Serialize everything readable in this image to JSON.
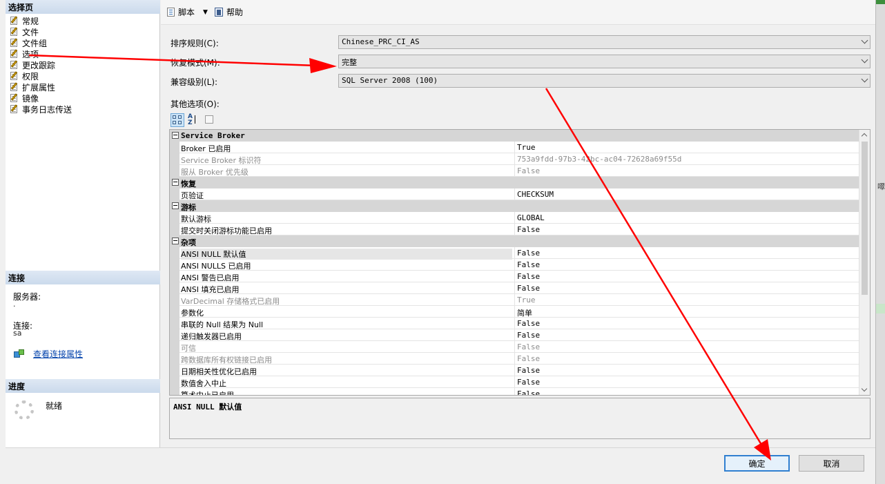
{
  "left": {
    "select_page_header": "选择页",
    "pages": [
      {
        "label": "常规"
      },
      {
        "label": "文件"
      },
      {
        "label": "文件组"
      },
      {
        "label": "选项"
      },
      {
        "label": "更改跟踪"
      },
      {
        "label": "权限"
      },
      {
        "label": "扩展属性"
      },
      {
        "label": "镜像"
      },
      {
        "label": "事务日志传送"
      }
    ],
    "connection_header": "连接",
    "server_label": "服务器:",
    "server_value": ".",
    "connection_label": "连接:",
    "connection_value": "sa",
    "view_connection_link": "查看连接属性",
    "progress_header": "进度",
    "progress_status": "就绪"
  },
  "toolbar": {
    "script_label": "脚本",
    "script_caret": "▼",
    "help_label": "帮助"
  },
  "form": {
    "collation_label": "排序规则(C):",
    "collation_value": "Chinese_PRC_CI_AS",
    "recovery_label": "恢复模式(M):",
    "recovery_value": "完整",
    "compat_label": "兼容级别(L):",
    "compat_value": "SQL Server 2008 (100)",
    "other_options_label": "其他选项(O):"
  },
  "grid": {
    "rows": [
      {
        "kind": "cat",
        "name": "Service Broker"
      },
      {
        "kind": "prop",
        "name": "Broker 已启用",
        "value": "True",
        "disabled": false
      },
      {
        "kind": "prop",
        "name": "Service Broker 标识符",
        "value": "753a9fdd-97b3-42bc-ac04-72628a69f55d",
        "disabled": true
      },
      {
        "kind": "prop",
        "name": "服从 Broker 优先级",
        "value": "False",
        "disabled": true
      },
      {
        "kind": "cat",
        "name": "恢复"
      },
      {
        "kind": "prop",
        "name": "页验证",
        "value": "CHECKSUM",
        "disabled": false
      },
      {
        "kind": "cat",
        "name": "游标"
      },
      {
        "kind": "prop",
        "name": "默认游标",
        "value": "GLOBAL",
        "disabled": false
      },
      {
        "kind": "prop",
        "name": "提交时关闭游标功能已启用",
        "value": "False",
        "disabled": false
      },
      {
        "kind": "cat",
        "name": "杂项"
      },
      {
        "kind": "prop",
        "name": "ANSI NULL 默认值",
        "value": "False",
        "disabled": false,
        "selected": true
      },
      {
        "kind": "prop",
        "name": "ANSI NULLS 已启用",
        "value": "False",
        "disabled": false
      },
      {
        "kind": "prop",
        "name": "ANSI 警告已启用",
        "value": "False",
        "disabled": false
      },
      {
        "kind": "prop",
        "name": "ANSI 填充已启用",
        "value": "False",
        "disabled": false
      },
      {
        "kind": "prop",
        "name": "VarDecimal 存储格式已启用",
        "value": "True",
        "disabled": true
      },
      {
        "kind": "prop",
        "name": "参数化",
        "value": "简单",
        "disabled": false
      },
      {
        "kind": "prop",
        "name": "串联的 Null 结果为 Null",
        "value": "False",
        "disabled": false
      },
      {
        "kind": "prop",
        "name": "递归触发器已启用",
        "value": "False",
        "disabled": false
      },
      {
        "kind": "prop",
        "name": "可信",
        "value": "False",
        "disabled": true
      },
      {
        "kind": "prop",
        "name": "跨数据库所有权链接已启用",
        "value": "False",
        "disabled": true
      },
      {
        "kind": "prop",
        "name": "日期相关性优化已启用",
        "value": "False",
        "disabled": false
      },
      {
        "kind": "prop",
        "name": "数值舍入中止",
        "value": "False",
        "disabled": false
      },
      {
        "kind": "prop",
        "name": "算术中止已启用",
        "value": "False",
        "disabled": false
      }
    ]
  },
  "description": {
    "title": "ANSI NULL 默认值"
  },
  "buttons": {
    "ok_label": "确定",
    "cancel_label": "取消"
  },
  "colors": {
    "annotation_arrow": "#ff0000",
    "header_blue": "#cbdaec",
    "link": "#0645ad"
  }
}
